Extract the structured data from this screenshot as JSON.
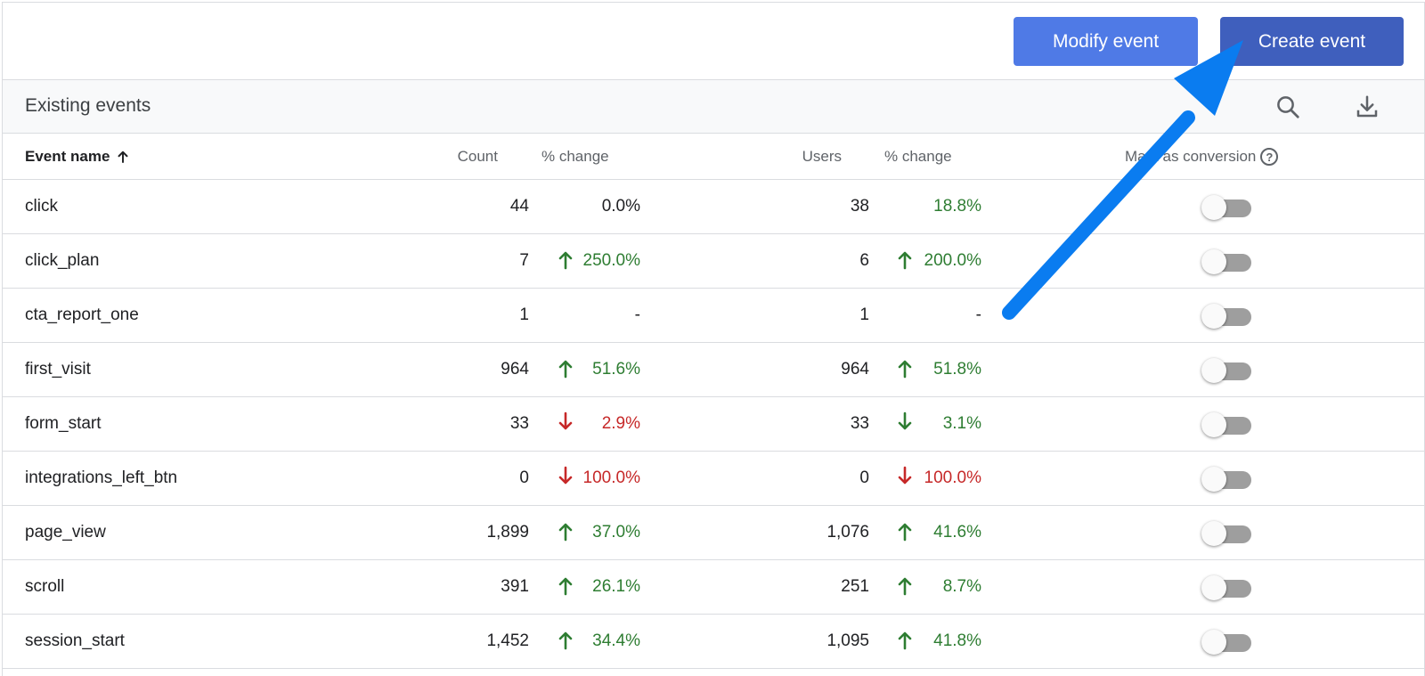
{
  "toolbar": {
    "modify_label": "Modify event",
    "create_label": "Create event"
  },
  "header": {
    "title": "Existing events",
    "search_icon": "search-icon",
    "download_icon": "download-icon"
  },
  "columns": {
    "event_name": "Event name",
    "count": "Count",
    "count_change": "% change",
    "users": "Users",
    "users_change": "% change",
    "conversion": "Mark as conversion",
    "help": "?"
  },
  "colors": {
    "up": "#2e7d32",
    "down": "#c62828",
    "modify_button": "#4f7ae6",
    "create_button": "#3f5fbd",
    "annotation_arrow": "#1a73e8"
  },
  "rows": [
    {
      "name": "click",
      "count": "44",
      "count_change": "0.0%",
      "count_dir": "none",
      "users": "38",
      "users_change": "18.8%",
      "users_dir": "up-noicon",
      "conversion": false
    },
    {
      "name": "click_plan",
      "count": "7",
      "count_change": "250.0%",
      "count_dir": "up",
      "users": "6",
      "users_change": "200.0%",
      "users_dir": "up",
      "conversion": false
    },
    {
      "name": "cta_report_one",
      "count": "1",
      "count_change": "-",
      "count_dir": "none",
      "users": "1",
      "users_change": "-",
      "users_dir": "none",
      "conversion": false
    },
    {
      "name": "first_visit",
      "count": "964",
      "count_change": "51.6%",
      "count_dir": "up",
      "users": "964",
      "users_change": "51.8%",
      "users_dir": "up",
      "conversion": false
    },
    {
      "name": "form_start",
      "count": "33",
      "count_change": "2.9%",
      "count_dir": "down",
      "users": "33",
      "users_change": "3.1%",
      "users_dir": "down-green",
      "conversion": false
    },
    {
      "name": "integrations_left_btn",
      "count": "0",
      "count_change": "100.0%",
      "count_dir": "down",
      "users": "0",
      "users_change": "100.0%",
      "users_dir": "down",
      "conversion": false
    },
    {
      "name": "page_view",
      "count": "1,899",
      "count_change": "37.0%",
      "count_dir": "up",
      "users": "1,076",
      "users_change": "41.6%",
      "users_dir": "up",
      "conversion": false
    },
    {
      "name": "scroll",
      "count": "391",
      "count_change": "26.1%",
      "count_dir": "up",
      "users": "251",
      "users_change": "8.7%",
      "users_dir": "up",
      "conversion": false
    },
    {
      "name": "session_start",
      "count": "1,452",
      "count_change": "34.4%",
      "count_dir": "up",
      "users": "1,095",
      "users_change": "41.8%",
      "users_dir": "up",
      "conversion": false
    }
  ]
}
